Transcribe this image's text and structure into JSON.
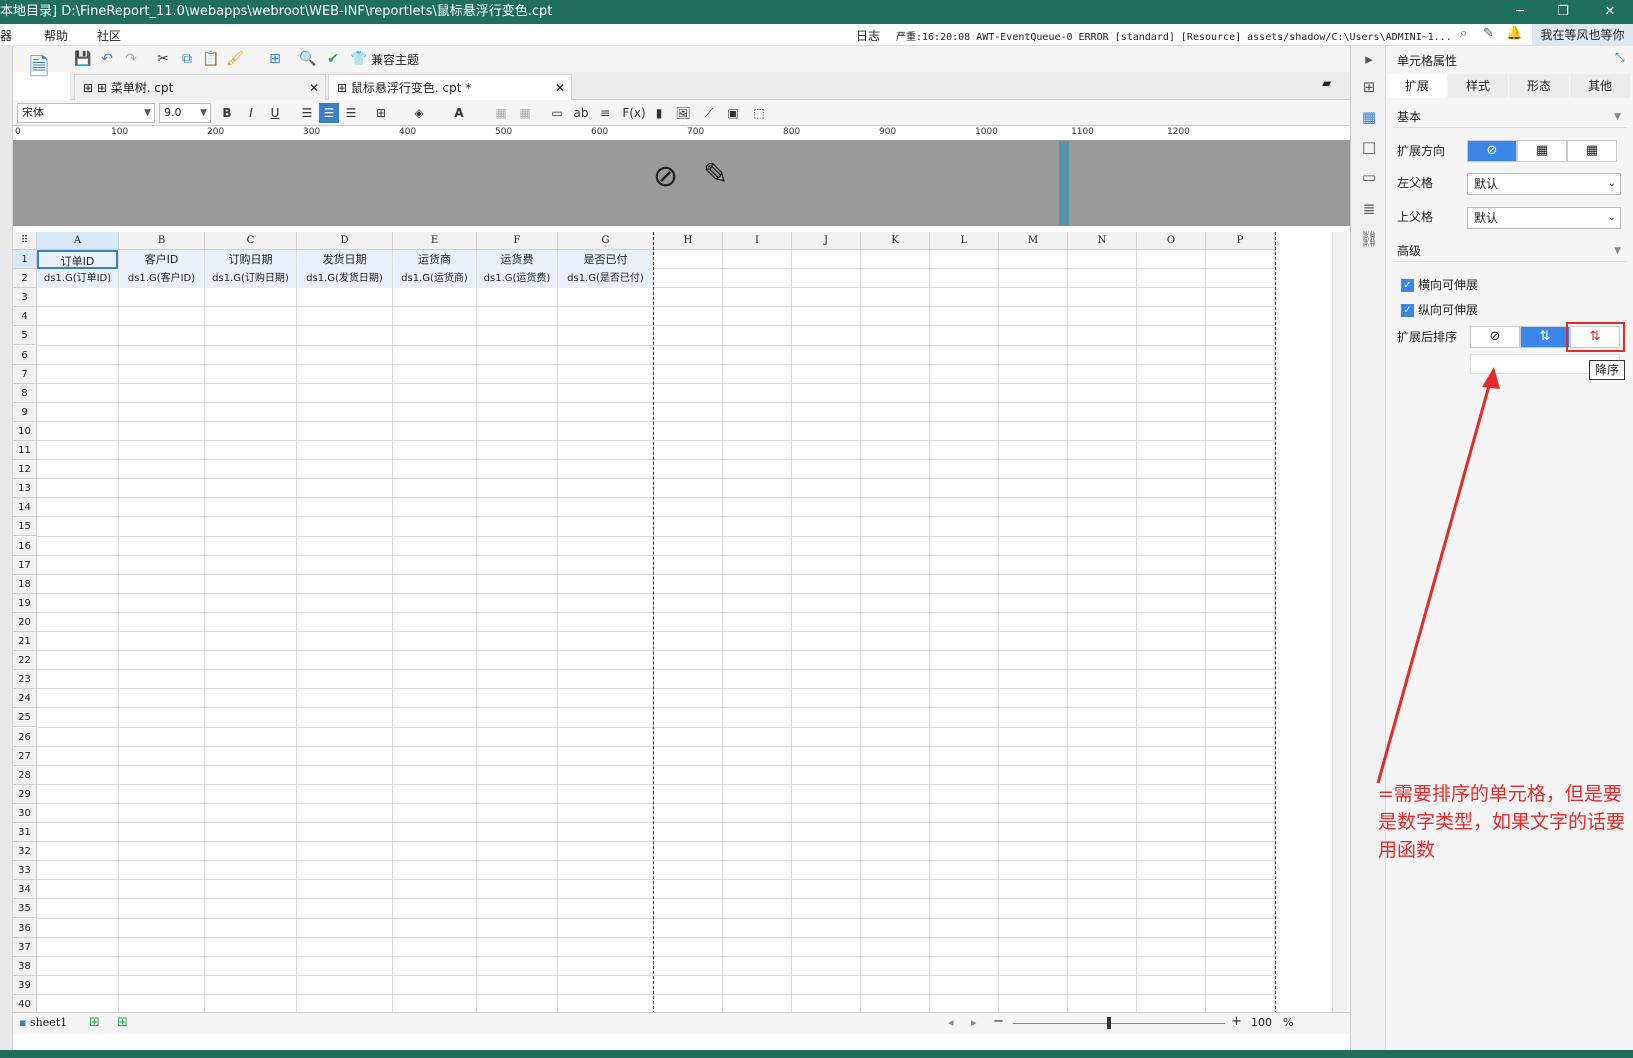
{
  "titlebar": {
    "path": "本地目录]   D:\\FineReport_11.0\\webapps\\webroot\\WEB-INF\\reportlets\\鼠标悬浮行变色.cpt",
    "minimize": "─",
    "restore": "❐",
    "close": "✕"
  },
  "menubar": {
    "items": [
      "器",
      "帮助",
      "社区"
    ],
    "log_prefix": "日志",
    "log": "严重:16:20:08 AWT-EventQueue-0 ERROR [standard] [Resource] assets/shadow/C:\\Users\\ADMINI~1...",
    "user": "我在等风也等你"
  },
  "toolbar": {
    "theme_label": "兼容主题"
  },
  "tabs": [
    {
      "label": "菜单树. cpt"
    },
    {
      "label": "鼠标悬浮行变色. cpt *"
    }
  ],
  "format": {
    "font": "宋体",
    "size": "9.0",
    "bold": "B",
    "italic": "I",
    "underline": "U",
    "text_ab": "ab",
    "fx": "F(x)"
  },
  "ruler": [
    "0",
    "100",
    "200",
    "300",
    "400",
    "500",
    "600",
    "700",
    "800",
    "900",
    "1000",
    "1100",
    "1200"
  ],
  "grid": {
    "columns": [
      "A",
      "B",
      "C",
      "D",
      "E",
      "F",
      "G",
      "H",
      "I",
      "J",
      "K",
      "L",
      "M",
      "N",
      "O",
      "P"
    ],
    "header_row": [
      "订单ID",
      "客户ID",
      "订购日期",
      "发货日期",
      "运货商",
      "运货费",
      "是否已付"
    ],
    "expand_row": [
      "ds1.G(订单ID)",
      "ds1.G(客户ID)",
      "ds1.G(订购日期)",
      "ds1.G(发货日期)",
      "ds1.G(运货商)",
      "ds1.G(运货费)",
      "ds1.G(是否已付)"
    ]
  },
  "bottom": {
    "sheet": "sheet1",
    "zoom": "100",
    "percent": "%"
  },
  "panel": {
    "title": "单元格属性",
    "tabs": [
      "扩展",
      "样式",
      "形态",
      "其他"
    ],
    "basic": "基本",
    "expand_direction": "扩展方向",
    "left_parent": "左父格",
    "left_parent_value": "默认",
    "top_parent": "上父格",
    "top_parent_value": "默认",
    "advanced": "高级",
    "h_expand": "横向可伸展",
    "v_expand": "纵向可伸展",
    "sort_after": "扩展后排序",
    "tooltip": "降序"
  },
  "annotation": "=需要排序的单元格，但是要是数字类型，如果文字的话要用函数",
  "colors": {
    "accent": "#3b87e8",
    "titlebar": "#1f6f5c",
    "annotation": "#e52a2a"
  }
}
